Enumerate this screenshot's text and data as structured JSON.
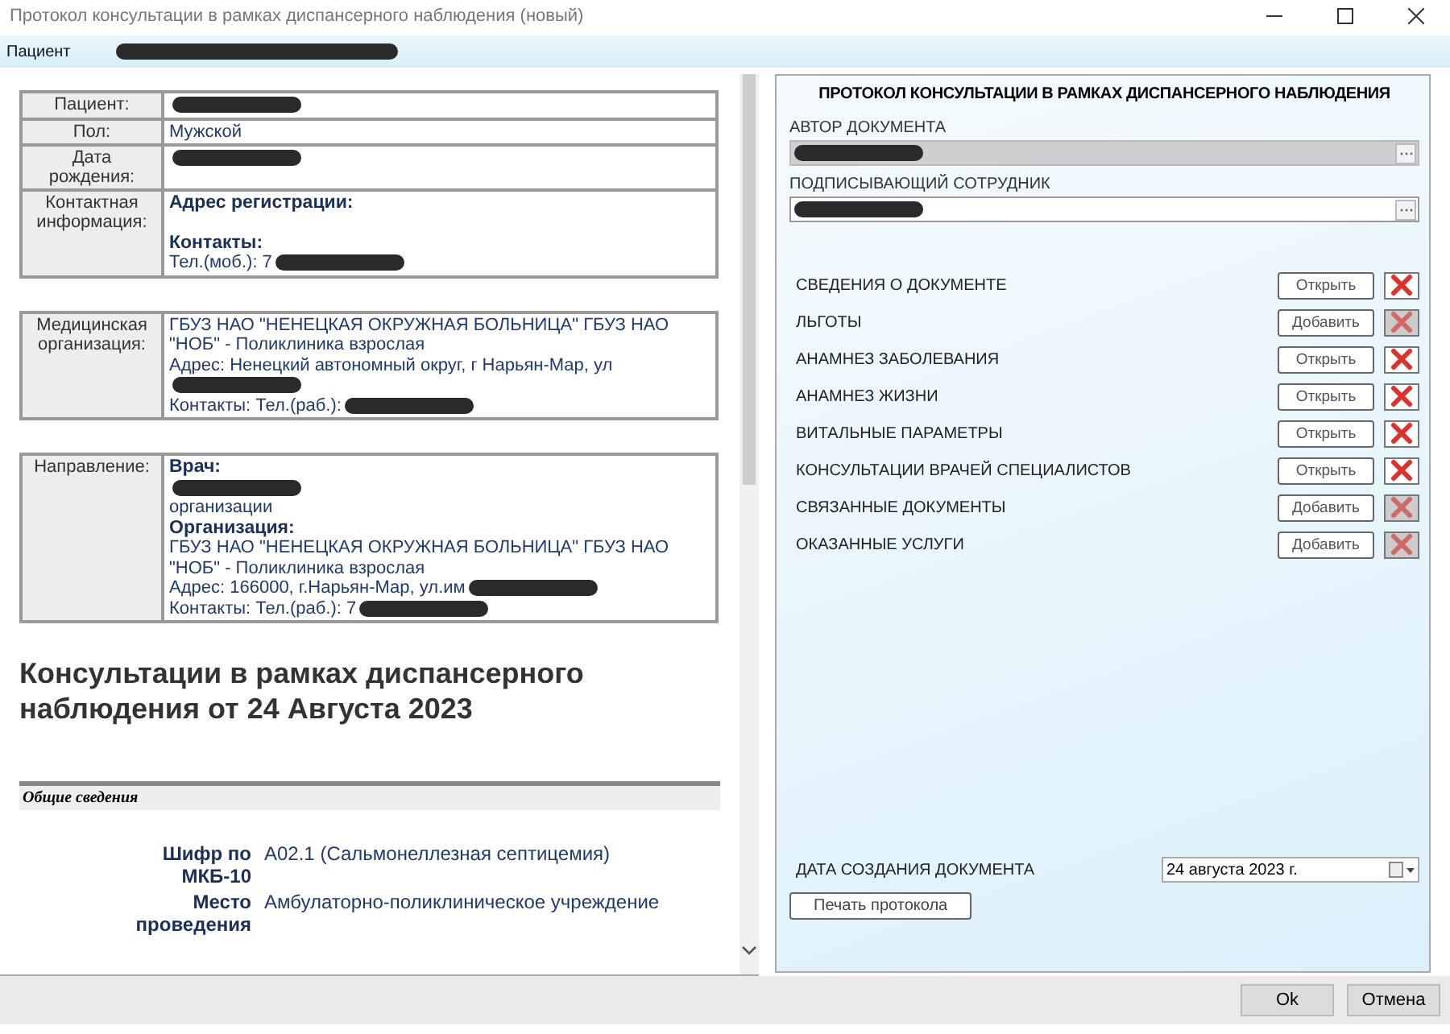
{
  "window": {
    "title": "Протокол консультации в рамках диспансерного наблюдения (новый)"
  },
  "patient_bar": {
    "label": "Пациент",
    "value_redacted": true
  },
  "document": {
    "tables": [
      {
        "rows": [
          {
            "label": "Пациент:",
            "lines": [
              {
                "kind": "text",
                "redacted": true
              }
            ]
          },
          {
            "label": "Пол:",
            "lines": [
              {
                "kind": "text",
                "text": "Мужской"
              }
            ]
          },
          {
            "label": "Дата рождения:",
            "lines": [
              {
                "kind": "text",
                "redacted": true
              }
            ]
          },
          {
            "label": "Контактная информация:",
            "lines": [
              {
                "kind": "heading",
                "text": "Адрес регистрации:"
              },
              {
                "kind": "spacer"
              },
              {
                "kind": "heading",
                "text": "Контакты:"
              },
              {
                "kind": "text",
                "text": "Тел.(моб.): 7",
                "redacted": true
              }
            ]
          }
        ]
      },
      {
        "rows": [
          {
            "label": "Медицинская организация:",
            "lines": [
              {
                "kind": "text",
                "text": "ГБУЗ НАО \"НЕНЕЦКАЯ ОКРУЖНАЯ БОЛЬНИЦА\" ГБУЗ НАО \"НОБ\" - Поликлиника взрослая"
              },
              {
                "kind": "text",
                "text": "Адрес: Ненецкий автономный округ, г Нарьян-Мар, ул"
              },
              {
                "kind": "text",
                "redacted": true
              },
              {
                "kind": "text",
                "text": "Контакты: Тел.(раб.):",
                "redacted": true
              }
            ]
          }
        ]
      },
      {
        "rows": [
          {
            "label": "Направление:",
            "lines": [
              {
                "kind": "heading",
                "text": "Врач:"
              },
              {
                "kind": "text",
                "redacted": true
              },
              {
                "kind": "text",
                "text": "организации"
              },
              {
                "kind": "heading",
                "text": "Организация:"
              },
              {
                "kind": "text",
                "text": "ГБУЗ НАО \"НЕНЕЦКАЯ ОКРУЖНАЯ БОЛЬНИЦА\" ГБУЗ НАО \"НОБ\" - Поликлиника взрослая"
              },
              {
                "kind": "text",
                "text": "Адрес: 166000, г.Нарьян-Мар, ул.им",
                "redacted": true
              },
              {
                "kind": "text",
                "text": "Контакты: Тел.(раб.): 7",
                "redacted": true
              }
            ]
          }
        ]
      }
    ],
    "heading": "Консультации в рамках диспансерного наблюдения от 24 Августа 2023",
    "section_title": "Общие сведения",
    "details": [
      {
        "label": "Шифр по МКБ-10",
        "value": "A02.1 (Сальмонеллезная септицемия)"
      },
      {
        "label": "Место проведения",
        "value": "Амбулаторно-поликлиническое учреждение"
      }
    ]
  },
  "form": {
    "title": "ПРОТОКОЛ КОНСУЛЬТАЦИИ В РАМКАХ ДИСПАНСЕРНОГО НАБЛЮДЕНИЯ",
    "fields": [
      {
        "label": "АВТОР ДОКУМЕНТА",
        "disabled": true,
        "value_redacted": true
      },
      {
        "label": "ПОДПИСЫВАЮЩИЙ СОТРУДНИК",
        "disabled": false,
        "value_redacted": true
      }
    ],
    "sections": [
      {
        "label": "СВЕДЕНИЯ О ДОКУМЕНТЕ",
        "action": "Открыть",
        "delete_enabled": true
      },
      {
        "label": "ЛЬГОТЫ",
        "action": "Добавить",
        "delete_enabled": false
      },
      {
        "label": "АНАМНЕЗ ЗАБОЛЕВАНИЯ",
        "action": "Открыть",
        "delete_enabled": true
      },
      {
        "label": "АНАМНЕЗ ЖИЗНИ",
        "action": "Открыть",
        "delete_enabled": true
      },
      {
        "label": "ВИТАЛЬНЫЕ ПАРАМЕТРЫ",
        "action": "Открыть",
        "delete_enabled": true
      },
      {
        "label": "КОНСУЛЬТАЦИИ ВРАЧЕЙ СПЕЦИАЛИСТОВ",
        "action": "Открыть",
        "delete_enabled": true
      },
      {
        "label": "СВЯЗАННЫЕ ДОКУМЕНТЫ",
        "action": "Добавить",
        "delete_enabled": false
      },
      {
        "label": "ОКАЗАННЫЕ УСЛУГИ",
        "action": "Добавить",
        "delete_enabled": false
      }
    ],
    "date": {
      "label": "ДАТА СОЗДАНИЯ ДОКУМЕНТА",
      "value": "24  августа  2023 г."
    },
    "print_button": "Печать протокола"
  },
  "buttons": [
    "Ok",
    "Отмена"
  ]
}
